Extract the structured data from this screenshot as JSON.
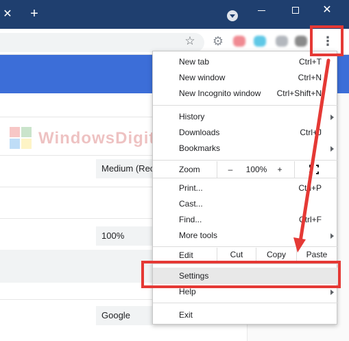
{
  "titlebar": {
    "tab_close_glyph": "✕",
    "new_tab_glyph": "+",
    "close_glyph": "✕"
  },
  "toolbar": {
    "star_glyph": "☆",
    "gear_glyph": "⚙",
    "kebab_glyph": "⋮"
  },
  "watermark": {
    "text": "WindowsDigital.com"
  },
  "page": {
    "font_size_value": "Medium (Recommended)",
    "zoom_value": "100%",
    "search_engine_value": "Google"
  },
  "menu": {
    "new_tab": {
      "label": "New tab",
      "shortcut": "Ctrl+T"
    },
    "new_window": {
      "label": "New window",
      "shortcut": "Ctrl+N"
    },
    "new_incognito": {
      "label": "New Incognito window",
      "shortcut": "Ctrl+Shift+N"
    },
    "history": {
      "label": "History"
    },
    "downloads": {
      "label": "Downloads",
      "shortcut": "Ctrl+J"
    },
    "bookmarks": {
      "label": "Bookmarks"
    },
    "zoom": {
      "label": "Zoom",
      "minus": "–",
      "value": "100%",
      "plus": "+"
    },
    "print": {
      "label": "Print...",
      "shortcut": "Ctrl+P"
    },
    "cast": {
      "label": "Cast..."
    },
    "find": {
      "label": "Find...",
      "shortcut": "Ctrl+F"
    },
    "more_tools": {
      "label": "More tools"
    },
    "edit": {
      "label": "Edit",
      "cut": "Cut",
      "copy": "Copy",
      "paste": "Paste"
    },
    "settings": {
      "label": "Settings"
    },
    "help": {
      "label": "Help"
    },
    "exit": {
      "label": "Exit"
    }
  },
  "colors": {
    "titlebar": "#1f3f6f",
    "accent_blue": "#3c6ed8",
    "highlight_red": "#e53935"
  }
}
